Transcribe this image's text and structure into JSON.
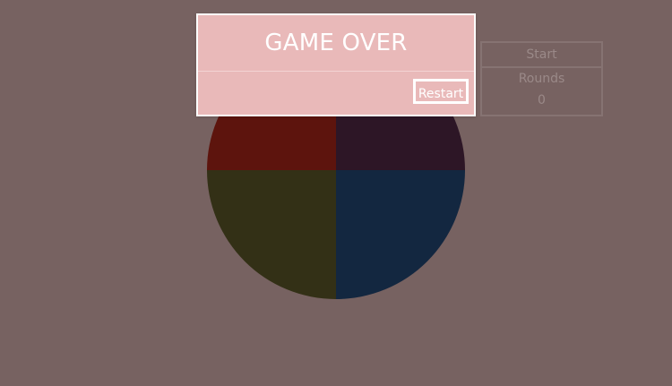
{
  "game": {
    "quadrant_colors": {
      "top_left": "#5d140d",
      "top_right": "#2d1626",
      "bottom_left": "#333016",
      "bottom_right": "#132740"
    }
  },
  "panel": {
    "start_label": "Start",
    "rounds_label": "Rounds",
    "rounds_value": "0"
  },
  "modal": {
    "title": "GAME OVER",
    "restart_label": "Restart"
  },
  "colors": {
    "background": "#776261",
    "modal_background": "#e9b9b9",
    "modal_text": "#ffffff"
  }
}
